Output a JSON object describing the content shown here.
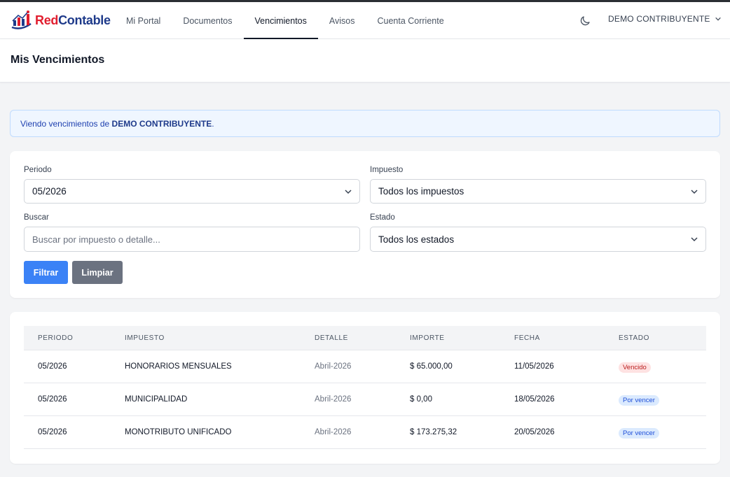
{
  "brand": {
    "name_part1": "Red",
    "name_part2": "Contable"
  },
  "nav": {
    "items": [
      {
        "label": "Mi Portal",
        "active": false
      },
      {
        "label": "Documentos",
        "active": false
      },
      {
        "label": "Vencimientos",
        "active": true
      },
      {
        "label": "Avisos",
        "active": false
      },
      {
        "label": "Cuenta Corriente",
        "active": false
      }
    ],
    "theme_icon": "moon-icon",
    "user": "DEMO CONTRIBUYENTE"
  },
  "header": {
    "title": "Mis Vencimientos"
  },
  "info": {
    "prefix": "Viendo vencimientos de ",
    "name": "DEMO CONTRIBUYENTE",
    "suffix": "."
  },
  "filters": {
    "periodo": {
      "label": "Periodo",
      "value": "05/2026"
    },
    "impuesto": {
      "label": "Impuesto",
      "value": "Todos los impuestos"
    },
    "buscar": {
      "label": "Buscar",
      "placeholder": "Buscar por impuesto o detalle..."
    },
    "estado": {
      "label": "Estado",
      "value": "Todos los estados"
    },
    "filter_button": "Filtrar",
    "clear_button": "Limpiar"
  },
  "table": {
    "columns": [
      "PERIODO",
      "IMPUESTO",
      "DETALLE",
      "IMPORTE",
      "FECHA",
      "ESTADO"
    ],
    "rows": [
      {
        "periodo": "05/2026",
        "impuesto": "HONORARIOS MENSUALES",
        "detalle": "Abril-2026",
        "importe": "$ 65.000,00",
        "fecha": "11/05/2026",
        "estado": "Vencido"
      },
      {
        "periodo": "05/2026",
        "impuesto": "MUNICIPALIDAD",
        "detalle": "Abril-2026",
        "importe": "$ 0,00",
        "fecha": "18/05/2026",
        "estado": "Por vencer"
      },
      {
        "periodo": "05/2026",
        "impuesto": "MONOTRIBUTO UNIFICADO",
        "detalle": "Abril-2026",
        "importe": "$ 173.275,32",
        "fecha": "20/05/2026",
        "estado": "Por vencer"
      }
    ]
  },
  "colors": {
    "primary": "#3b82f6",
    "secondary": "#6b7280",
    "brand_red": "#e11d2e",
    "brand_blue": "#1e3a8a",
    "badge_vencido": "#fee2e2",
    "badge_por_vencer": "#dbeafe"
  }
}
